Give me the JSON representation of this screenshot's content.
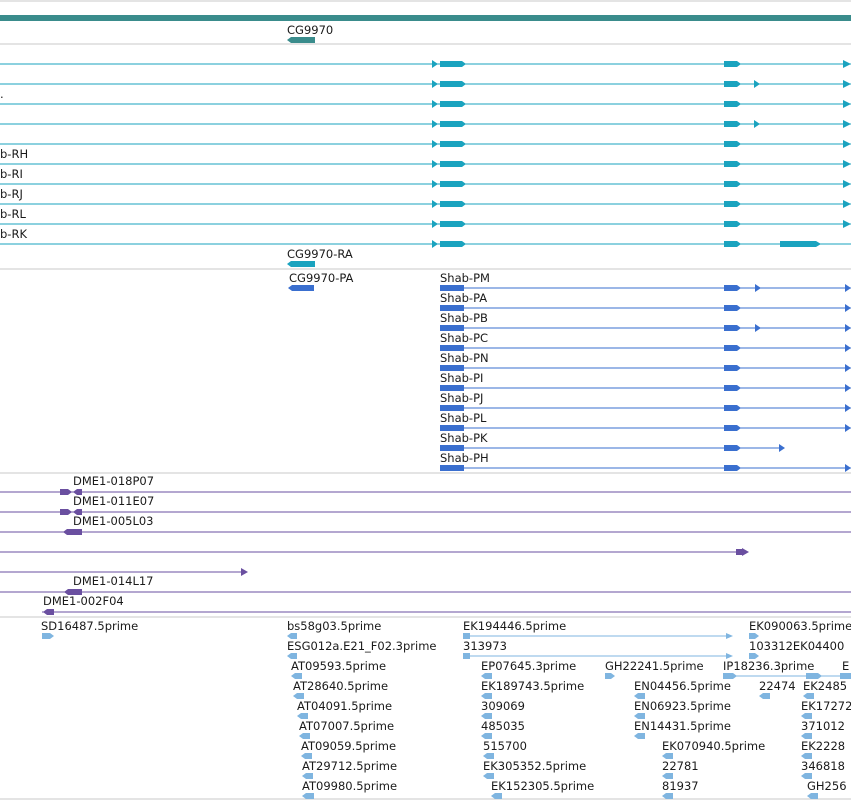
{
  "colors": {
    "gene": "#3a8c8c",
    "transcript": "#1aa3bf",
    "protein": "#3a6fcf",
    "clone": "#6a4fa0",
    "est": "#7fb5e0",
    "separator": "#c8c8c8"
  },
  "gene_track": {
    "items": [
      {
        "id": "gene-cg9970",
        "label": "CG9970"
      }
    ]
  },
  "transcript_track": {
    "items": [
      {
        "id": "transcript-0",
        "label": ""
      },
      {
        "id": "transcript-1",
        "label": ""
      },
      {
        "id": "transcript-2",
        "label": "."
      },
      {
        "id": "transcript-3",
        "label": ""
      },
      {
        "id": "transcript-4",
        "label": ""
      },
      {
        "id": "transcript-shab-rh",
        "label": "b-RH"
      },
      {
        "id": "transcript-shab-ri",
        "label": "b-RI"
      },
      {
        "id": "transcript-shab-rj",
        "label": "b-RJ"
      },
      {
        "id": "transcript-shab-rl",
        "label": "b-RL"
      },
      {
        "id": "transcript-shab-rk",
        "label": "b-RK"
      },
      {
        "id": "transcript-cg9970-ra",
        "label": "CG9970-RA"
      }
    ]
  },
  "protein_track": {
    "items": [
      {
        "id": "protein-cg9970-pa",
        "label": "CG9970-PA"
      },
      {
        "id": "protein-shab-pm",
        "label": "Shab-PM"
      },
      {
        "id": "protein-shab-pa",
        "label": "Shab-PA"
      },
      {
        "id": "protein-shab-pb",
        "label": "Shab-PB"
      },
      {
        "id": "protein-shab-pc",
        "label": "Shab-PC"
      },
      {
        "id": "protein-shab-pn",
        "label": "Shab-PN"
      },
      {
        "id": "protein-shab-pi",
        "label": "Shab-PI"
      },
      {
        "id": "protein-shab-pj",
        "label": "Shab-PJ"
      },
      {
        "id": "protein-shab-pl",
        "label": "Shab-PL"
      },
      {
        "id": "protein-shab-pk",
        "label": "Shab-PK"
      },
      {
        "id": "protein-shab-ph",
        "label": "Shab-PH"
      }
    ]
  },
  "clone_track": {
    "items": [
      {
        "id": "clone-018p07",
        "label": "DME1-018P07"
      },
      {
        "id": "clone-011e07",
        "label": "DME1-011E07"
      },
      {
        "id": "clone-005l03",
        "label": "DME1-005L03"
      },
      {
        "id": "clone-014l17",
        "label": "DME1-014L17"
      },
      {
        "id": "clone-002f04",
        "label": "DME1-002F04"
      }
    ]
  },
  "est_track": {
    "items": [
      {
        "id": "est-sd16487",
        "label": "SD16487.5prime"
      },
      {
        "id": "est-bs58g03",
        "label": "bs58g03.5prime"
      },
      {
        "id": "est-esg012a",
        "label": "ESG012a.E21_F02.3prime"
      },
      {
        "id": "est-at09593",
        "label": "AT09593.5prime"
      },
      {
        "id": "est-at28640",
        "label": "AT28640.5prime"
      },
      {
        "id": "est-at04091",
        "label": "AT04091.5prime"
      },
      {
        "id": "est-at07007",
        "label": "AT07007.5prime"
      },
      {
        "id": "est-at09059",
        "label": "AT09059.5prime"
      },
      {
        "id": "est-at29712",
        "label": "AT29712.5prime"
      },
      {
        "id": "est-at09980",
        "label": "AT09980.5prime"
      },
      {
        "id": "est-ek194446",
        "label": "EK194446.5prime"
      },
      {
        "id": "est-313973",
        "label": "313973"
      },
      {
        "id": "est-ep07645",
        "label": "EP07645.3prime"
      },
      {
        "id": "est-ek189743",
        "label": "EK189743.5prime"
      },
      {
        "id": "est-309069",
        "label": "309069"
      },
      {
        "id": "est-485035",
        "label": "485035"
      },
      {
        "id": "est-515700",
        "label": "515700"
      },
      {
        "id": "est-ek305352",
        "label": "EK305352.5prime"
      },
      {
        "id": "est-ek152305",
        "label": "EK152305.5prime"
      },
      {
        "id": "est-gh22241",
        "label": "GH22241.5prime"
      },
      {
        "id": "est-en04456",
        "label": "EN04456.5prime"
      },
      {
        "id": "est-en06923",
        "label": "EN06923.5prime"
      },
      {
        "id": "est-en14431",
        "label": "EN14431.5prime"
      },
      {
        "id": "est-ek070940",
        "label": "EK070940.5prime"
      },
      {
        "id": "est-22781",
        "label": "22781"
      },
      {
        "id": "est-81937",
        "label": "81937"
      },
      {
        "id": "est-ek090063",
        "label": "EK090063.5prime"
      },
      {
        "id": "est-103312",
        "label": "103312EK04400"
      },
      {
        "id": "est-ip18236",
        "label": "IP18236.3prime"
      },
      {
        "id": "est-e-cut",
        "label": "E"
      },
      {
        "id": "est-22474",
        "label": "22474"
      },
      {
        "id": "est-ek2485",
        "label": "EK2485"
      },
      {
        "id": "est-ek17272",
        "label": "EK17272"
      },
      {
        "id": "est-371012",
        "label": "371012"
      },
      {
        "id": "est-ek2228",
        "label": "EK2228"
      },
      {
        "id": "est-346818",
        "label": "346818"
      },
      {
        "id": "est-gh256",
        "label": "GH256"
      }
    ]
  }
}
